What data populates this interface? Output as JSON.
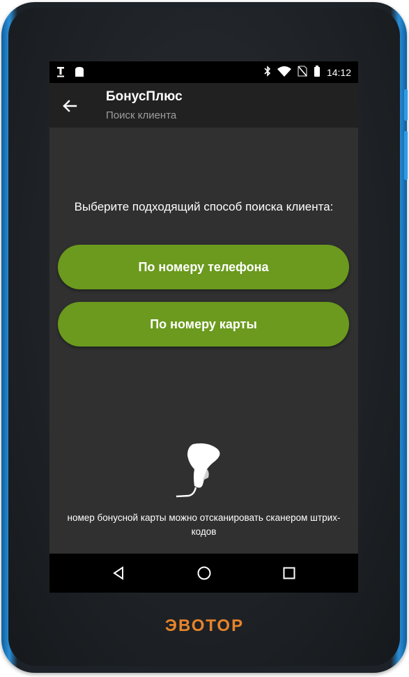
{
  "status_bar": {
    "time": "14:12",
    "left_icons": [
      "text-format-icon",
      "android-icon"
    ],
    "right_icons": [
      "bluetooth-icon",
      "wifi-icon",
      "no-sim-icon",
      "battery-icon"
    ]
  },
  "app_bar": {
    "back_icon": "arrow-left-icon",
    "title": "БонусПлюс",
    "subtitle": "Поиск клиента"
  },
  "main": {
    "prompt": "Выберите подходящий способ поиска клиента:",
    "buttons": {
      "phone_label": "По номеру телефона",
      "card_label": "По номеру карты"
    },
    "scanner_icon": "barcode-scanner-icon",
    "hint": "номер бонусной карты можно отсканировать сканером штрих-кодов"
  },
  "nav_bar": {
    "icons": [
      "back-triangle-icon",
      "home-circle-icon",
      "recents-square-icon"
    ]
  },
  "device": {
    "brand": "ЭВОТОР"
  },
  "colors": {
    "accent_green": "#6b9a1e",
    "screen_bg": "#303030",
    "appbar_bg": "#212121",
    "brand_orange": "#e8842a",
    "device_edge_blue": "#2a8fd8"
  }
}
